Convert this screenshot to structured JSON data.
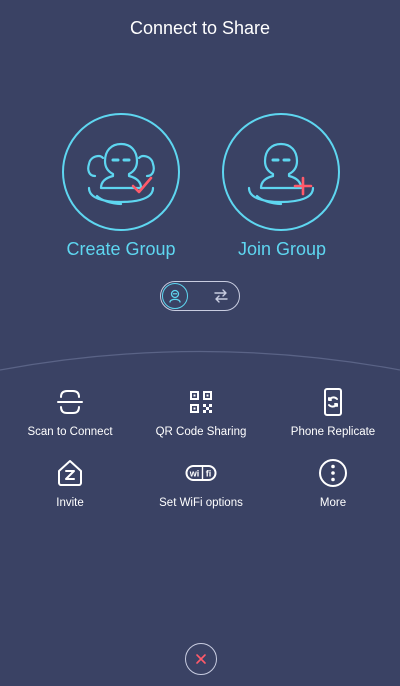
{
  "header": {
    "title": "Connect to Share"
  },
  "actions": {
    "create_group": "Create Group",
    "join_group": "Join Group"
  },
  "options": [
    {
      "label": "Scan to Connect",
      "icon": "scan-icon"
    },
    {
      "label": "QR Code Sharing",
      "icon": "qr-code-icon"
    },
    {
      "label": "Phone Replicate",
      "icon": "phone-replicate-icon"
    },
    {
      "label": "Invite",
      "icon": "invite-icon"
    },
    {
      "label": "Set WiFi options",
      "icon": "wifi-icon"
    },
    {
      "label": "More",
      "icon": "more-icon"
    }
  ],
  "wifi_icon_text": "wi fi",
  "colors": {
    "background": "#3a4264",
    "accent": "#5ed6f0",
    "highlight": "#ff5a6a",
    "text": "#ffffff"
  }
}
